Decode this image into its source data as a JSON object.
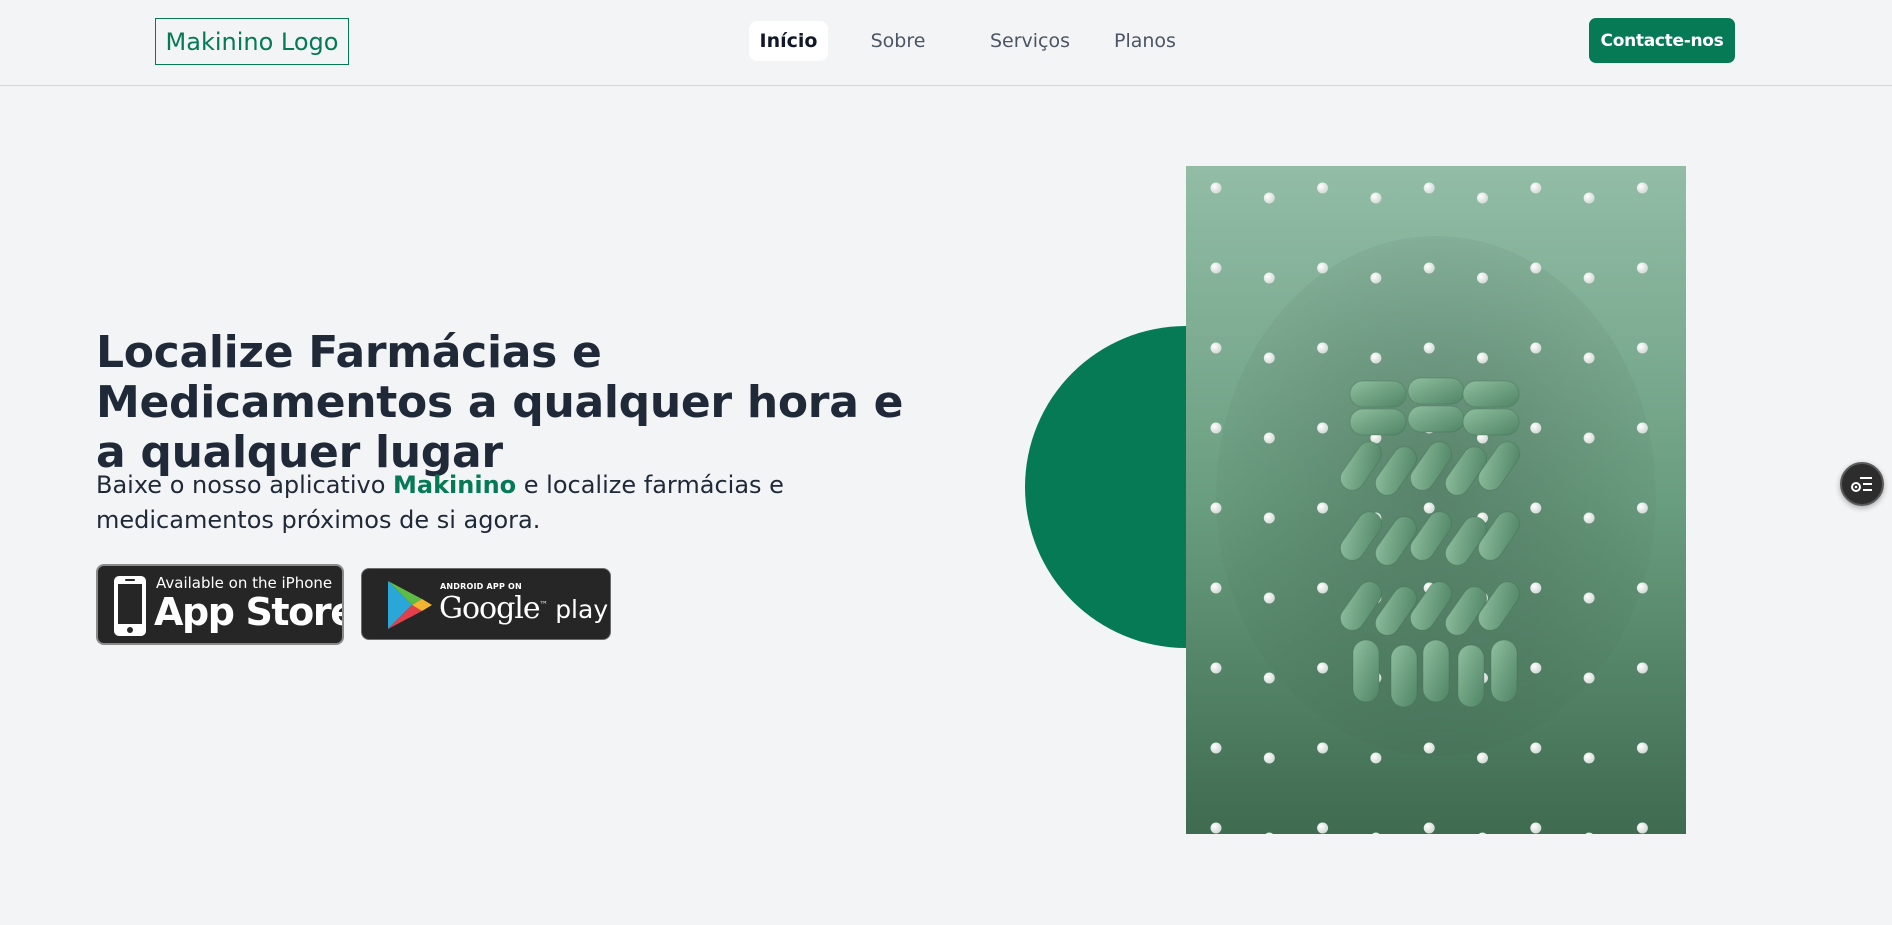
{
  "header": {
    "logo_text": "Makinino Logo",
    "nav": [
      {
        "label": "Início",
        "active": true
      },
      {
        "label": "Sobre",
        "active": false
      },
      {
        "label": "Serviços",
        "active": false
      },
      {
        "label": "Planos",
        "active": false
      }
    ],
    "cta_label": "Contacte-nos"
  },
  "hero": {
    "title": "Localize Farmácias e Medicamentos a qualquer hora e a qualquer lugar",
    "description_prefix": "Baixe o nosso aplicativo ",
    "description_brand": "Makinino",
    "description_suffix": " e localize farmácias e medicamentos próximos de si agora.",
    "badges": {
      "appstore": {
        "small": "Available on the iPhone",
        "big": "App Store"
      },
      "google": {
        "small": "ANDROID APP ON",
        "big": "Google",
        "big_suffix": "play"
      }
    },
    "image_icon": "pills-illustration"
  },
  "floating_button": {
    "icon": "settings-list-icon"
  },
  "colors": {
    "brand": "#057a55",
    "background": "#f3f4f6",
    "text": "#1f2937",
    "image_green": "#6a9e80"
  }
}
